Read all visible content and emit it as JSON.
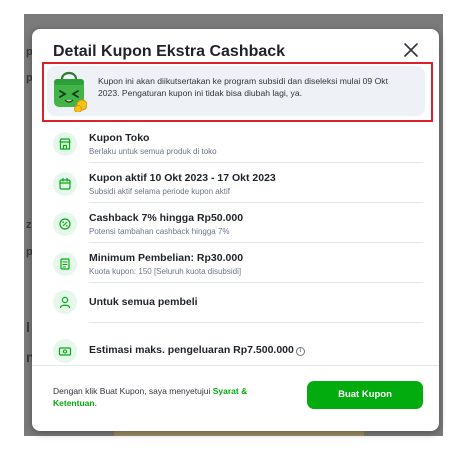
{
  "background": {
    "left_marks": [
      "p",
      "p",
      "z",
      "p",
      "l",
      "n"
    ]
  },
  "modal": {
    "title": "Detail Kupon Ekstra Cashback",
    "close_icon": "close-icon",
    "notice": {
      "text_line1": "Kupon ini akan diikutsertakan ke program subsidi dan diseleksi mulai 09 Okt",
      "text_line2": "2023. Pengaturan kupon ini tidak bisa diubah lagi, ya.",
      "mascot_icon": "shopping-bag-mascot-icon"
    },
    "items": [
      {
        "title": "Kupon Toko",
        "subtitle": "Berlaku untuk semua produk di toko",
        "icon": "store-icon"
      },
      {
        "title": "Kupon aktif 10 Okt 2023 - 17 Okt 2023",
        "subtitle": "Subsidi aktif selama periode kupon aktif",
        "icon": "calendar-icon"
      },
      {
        "title": "Cashback 7% hingga Rp50.000",
        "subtitle": "Potensi tambahan cashback hingga 7%",
        "icon": "percent-badge-icon"
      },
      {
        "title": "Minimum Pembelian: Rp30.000",
        "subtitle": "Kuota kupon: 150 [Seluruh kuota disubsidi]",
        "icon": "receipt-icon"
      },
      {
        "title": "Untuk semua pembeli",
        "subtitle": "",
        "icon": "user-icon"
      },
      {
        "title": "Estimasi maks. pengeluaran Rp7.500.000",
        "subtitle": "",
        "icon": "money-icon",
        "info_icon": "info-icon"
      }
    ],
    "footer": {
      "terms_prefix": "Dengan klik Buat Kupon, saya menyetujui ",
      "terms_link": "Syarat & Ketentuan",
      "terms_suffix": ".",
      "button_label": "Buat Kupon"
    }
  },
  "colors": {
    "accent_green": "#03ac0e",
    "highlight_red": "#d8222b",
    "icon_bg": "#e6f7ec"
  }
}
